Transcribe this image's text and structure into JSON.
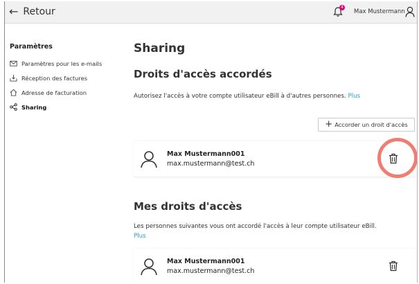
{
  "header": {
    "back_label": "Retour",
    "notification_count": "4",
    "user_name": "Max Mustermann"
  },
  "sidebar": {
    "title": "Paramètres",
    "items": [
      {
        "label": "Paramètres pour les e-mails",
        "icon": "envelope-icon"
      },
      {
        "label": "Réception des factures",
        "icon": "inbox-icon"
      },
      {
        "label": "Adresse de facturation",
        "icon": "home-icon"
      },
      {
        "label": "Sharing",
        "icon": "share-icon",
        "active": true
      }
    ]
  },
  "main": {
    "page_title": "Sharing",
    "granted": {
      "title": "Droits d'accès accordés",
      "description": "Autorisez l'accès à votre compte utilisateur eBill à d'autres personnes.",
      "more_link": "Plus",
      "add_button": "Accorder un droit d'accès",
      "entries": [
        {
          "name": "Max Mustermann001",
          "email": "max.mustermann@test.ch"
        }
      ]
    },
    "received": {
      "title": "Mes droits d'accès",
      "description": "Les personnes suivantes vous ont accordé l'accès à leur compte utilisateur eBill.",
      "more_link": "Plus",
      "entries": [
        {
          "name": "Max Mustermann001",
          "email": "max.mustermann@test.ch"
        }
      ]
    }
  },
  "colors": {
    "accent_link": "#2aa4c8",
    "badge": "#e6007a",
    "highlight_ring": "#ef7d72",
    "header_bg": "#f1f1f1"
  }
}
